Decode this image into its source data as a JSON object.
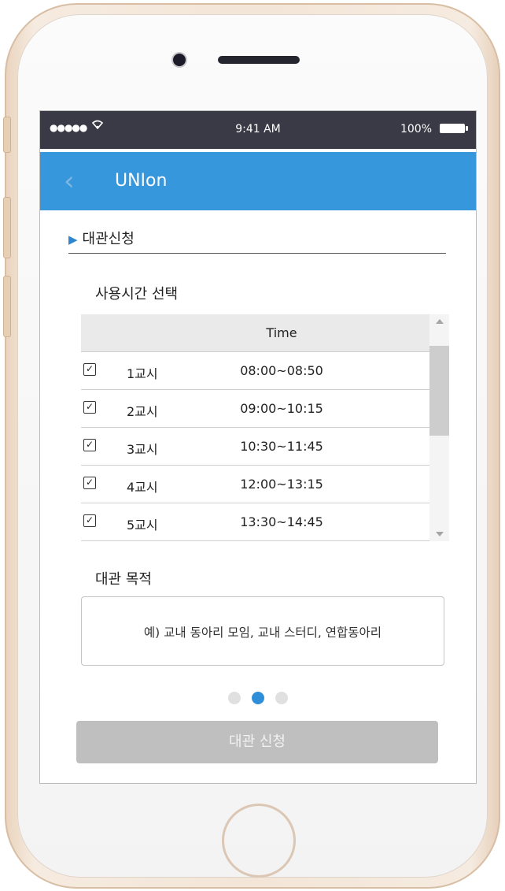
{
  "statusbar": {
    "signal": "●●●●●",
    "time": "9:41 AM",
    "battery": "100%"
  },
  "appbar": {
    "back": "‹",
    "title": "UNIon"
  },
  "section_title": "대관신청",
  "time_section": {
    "title": "사용시간 선택",
    "column_header": "Time",
    "rows": [
      {
        "period": "1교시",
        "time": "08:00~08:50",
        "checked": true
      },
      {
        "period": "2교시",
        "time": "09:00~10:15",
        "checked": true
      },
      {
        "period": "3교시",
        "time": "10:30~11:45",
        "checked": true
      },
      {
        "period": "4교시",
        "time": "12:00~13:15",
        "checked": true
      },
      {
        "period": "5교시",
        "time": "13:30~14:45",
        "checked": true
      }
    ]
  },
  "purpose_section": {
    "title": "대관 목적",
    "placeholder": "예) 교내 동아리 모임, 교내 스터디, 연합동아리"
  },
  "pagination": {
    "total": 3,
    "active": 2
  },
  "submit_label": "대관 신청",
  "colors": {
    "accent": "#3697dc",
    "statusbar": "#3a3a46",
    "button_disabled": "#bfbfbf"
  }
}
